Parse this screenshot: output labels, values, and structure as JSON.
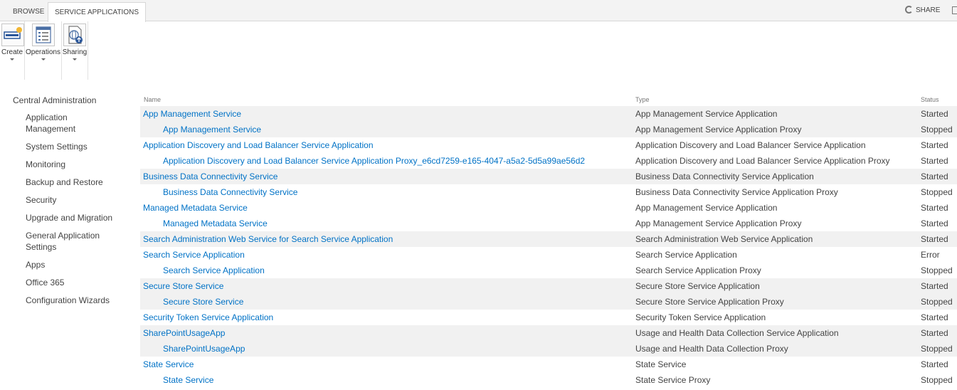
{
  "tabs": {
    "browse": "BROWSE",
    "service_applications": "SERVICE APPLICATIONS"
  },
  "share_label": "SHARE",
  "ribbon": {
    "create": "Create",
    "operations": "Operations",
    "sharing": "Sharing"
  },
  "nav": {
    "root": "Central Administration",
    "items": [
      {
        "label": "Application Management"
      },
      {
        "label": "System Settings"
      },
      {
        "label": "Monitoring"
      },
      {
        "label": "Backup and Restore"
      },
      {
        "label": "Security"
      },
      {
        "label": "Upgrade and Migration"
      },
      {
        "label": "General Application Settings"
      },
      {
        "label": "Apps"
      },
      {
        "label": "Office 365"
      },
      {
        "label": "Configuration Wizards"
      }
    ]
  },
  "table": {
    "headers": {
      "name": "Name",
      "type": "Type",
      "status": "Status"
    },
    "rows": [
      {
        "name": "App Management Service",
        "type": "App Management Service Application",
        "status": "Started"
      },
      {
        "name": "App Management Service",
        "type": "App Management Service Application Proxy",
        "status": "Stopped"
      },
      {
        "name": "Application Discovery and Load Balancer Service Application",
        "type": "Application Discovery and Load Balancer Service Application",
        "status": "Started"
      },
      {
        "name": "Application Discovery and Load Balancer Service Application Proxy_e6cd7259-e165-4047-a5a2-5d5a99ae56d2",
        "type": "Application Discovery and Load Balancer Service Application Proxy",
        "status": "Started"
      },
      {
        "name": "Business Data Connectivity Service",
        "type": "Business Data Connectivity Service Application",
        "status": "Started"
      },
      {
        "name": "Business Data Connectivity Service",
        "type": "Business Data Connectivity Service Application Proxy",
        "status": "Stopped"
      },
      {
        "name": "Managed Metadata Service",
        "type": "App Management Service Application",
        "status": "Started"
      },
      {
        "name": "Managed Metadata Service",
        "type": "App Management Service Application Proxy",
        "status": "Started"
      },
      {
        "name": "Search Administration Web Service for Search Service Application",
        "type": "Search Administration Web Service Application",
        "status": "Started"
      },
      {
        "name": "Search Service Application",
        "type": "Search Service Application",
        "status": "Error"
      },
      {
        "name": "Search Service Application",
        "type": "Search Service Application Proxy",
        "status": "Stopped"
      },
      {
        "name": "Secure Store Service",
        "type": "Secure Store Service Application",
        "status": "Started"
      },
      {
        "name": "Secure Store Service",
        "type": "Secure Store Service Application Proxy",
        "status": "Stopped"
      },
      {
        "name": "Security Token Service Application",
        "type": "Security Token Service Application",
        "status": "Started"
      },
      {
        "name": "SharePointUsageApp",
        "type": "Usage and Health Data Collection Service Application",
        "status": "Started"
      },
      {
        "name": "SharePointUsageApp",
        "type": "Usage and Health Data Collection Proxy",
        "status": "Stopped"
      },
      {
        "name": "State Service",
        "type": "State Service",
        "status": "Started"
      },
      {
        "name": "State Service",
        "type": "State Service Proxy",
        "status": "Stopped"
      }
    ]
  },
  "icons": {
    "create": "create-icon",
    "operations": "operations-icon",
    "sharing": "sharing-icon",
    "share": "share-icon",
    "focus": "focus-content-icon"
  },
  "colors": {
    "link": "#0072c6",
    "alt_row": "#f1f1f1",
    "text": "#444444"
  }
}
